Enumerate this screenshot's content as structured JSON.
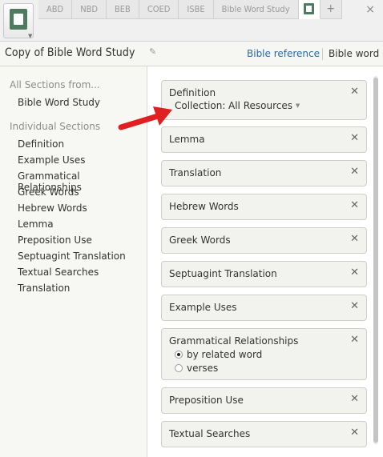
{
  "tabs": [
    "ABD",
    "NBD",
    "BEB",
    "COED",
    "ISBE",
    "Bible Word Study"
  ],
  "tab_add": "+",
  "tab_close": "×",
  "title": "Copy of Bible Word Study",
  "header_links": {
    "reference": "Bible reference",
    "word": "Bible word"
  },
  "sidebar": {
    "all_sections_heading": "All Sections from...",
    "all_sections_item": "Bible Word Study",
    "individual_heading": "Individual Sections",
    "items": [
      "Definition",
      "Example Uses",
      "Grammatical Relationships",
      "Greek Words",
      "Hebrew Words",
      "Lemma",
      "Preposition Use",
      "Septuagint Translation",
      "Textual Searches",
      "Translation"
    ]
  },
  "cards": {
    "definition": {
      "label": "Definition",
      "collection_label": "Collection:",
      "collection_value": "All Resources"
    },
    "lemma": "Lemma",
    "translation": "Translation",
    "hebrew": "Hebrew Words",
    "greek": "Greek Words",
    "septuagint": "Septuagint Translation",
    "example": "Example Uses",
    "grammatical": {
      "label": "Grammatical Relationships",
      "options": [
        "by related word",
        "verses"
      ],
      "selected": "by related word"
    },
    "preposition": "Preposition Use",
    "textual": "Textual Searches"
  },
  "remove_glyph": "✕",
  "colors": {
    "accent_link": "#2b6aa3",
    "arrow": "#e02020",
    "app_icon": "#4e7a60"
  }
}
